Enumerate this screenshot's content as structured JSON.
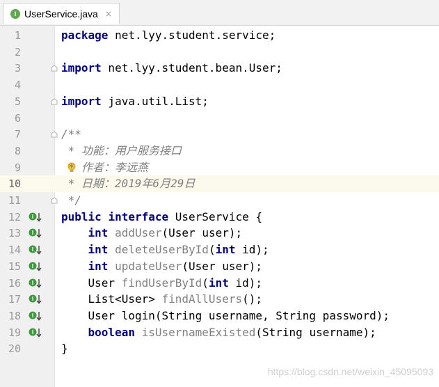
{
  "tab": {
    "icon_letter": "I",
    "file_name": "UserService.java",
    "close_label": "×"
  },
  "lines": [
    {
      "num": "1",
      "tokens": [
        {
          "t": "package",
          "c": "kw"
        },
        {
          "t": " net.lyy.student.service;",
          "c": "n"
        }
      ]
    },
    {
      "num": "2",
      "tokens": []
    },
    {
      "num": "3",
      "fold": true,
      "tokens": [
        {
          "t": "import",
          "c": "kw"
        },
        {
          "t": " net.lyy.student.bean.User;",
          "c": "n"
        }
      ]
    },
    {
      "num": "4",
      "tokens": []
    },
    {
      "num": "5",
      "fold": true,
      "tokens": [
        {
          "t": "import",
          "c": "kw"
        },
        {
          "t": " java.util.List;",
          "c": "n"
        }
      ]
    },
    {
      "num": "6",
      "tokens": []
    },
    {
      "num": "7",
      "fold": true,
      "tokens": [
        {
          "t": "/**",
          "c": "cm"
        }
      ]
    },
    {
      "num": "8",
      "tokens": [
        {
          "t": " * 功能：用户服务接口",
          "c": "cm"
        }
      ]
    },
    {
      "num": "9",
      "bulb": true,
      "tokens": [
        {
          "t": " * 作者：李远燕",
          "c": "cm"
        }
      ]
    },
    {
      "num": "10",
      "current": true,
      "tokens": [
        {
          "t": " * 日期：2019年6月29日",
          "c": "cm"
        }
      ]
    },
    {
      "num": "11",
      "fold": true,
      "tokens": [
        {
          "t": " */",
          "c": "cm"
        }
      ]
    },
    {
      "num": "12",
      "impl": true,
      "tokens": [
        {
          "t": "public",
          "c": "kw"
        },
        {
          "t": " ",
          "c": "n"
        },
        {
          "t": "interface",
          "c": "kw"
        },
        {
          "t": " UserService {",
          "c": "n"
        }
      ]
    },
    {
      "num": "13",
      "impl": true,
      "tokens": [
        {
          "t": "    ",
          "c": "n"
        },
        {
          "t": "int",
          "c": "kw"
        },
        {
          "t": " ",
          "c": "n"
        },
        {
          "t": "addUser",
          "c": "mt"
        },
        {
          "t": "(User user);",
          "c": "n"
        }
      ]
    },
    {
      "num": "14",
      "impl": true,
      "tokens": [
        {
          "t": "    ",
          "c": "n"
        },
        {
          "t": "int",
          "c": "kw"
        },
        {
          "t": " ",
          "c": "n"
        },
        {
          "t": "deleteUserById",
          "c": "mt"
        },
        {
          "t": "(",
          "c": "n"
        },
        {
          "t": "int",
          "c": "kw"
        },
        {
          "t": " id);",
          "c": "n"
        }
      ]
    },
    {
      "num": "15",
      "impl": true,
      "tokens": [
        {
          "t": "    ",
          "c": "n"
        },
        {
          "t": "int",
          "c": "kw"
        },
        {
          "t": " ",
          "c": "n"
        },
        {
          "t": "updateUser",
          "c": "mt"
        },
        {
          "t": "(User user);",
          "c": "n"
        }
      ]
    },
    {
      "num": "16",
      "impl": true,
      "tokens": [
        {
          "t": "    User ",
          "c": "n"
        },
        {
          "t": "findUserById",
          "c": "mt"
        },
        {
          "t": "(",
          "c": "n"
        },
        {
          "t": "int",
          "c": "kw"
        },
        {
          "t": " id);",
          "c": "n"
        }
      ]
    },
    {
      "num": "17",
      "impl": true,
      "tokens": [
        {
          "t": "    List<User> ",
          "c": "n"
        },
        {
          "t": "findAllUsers",
          "c": "mt"
        },
        {
          "t": "();",
          "c": "n"
        }
      ]
    },
    {
      "num": "18",
      "impl": true,
      "tokens": [
        {
          "t": "    User login(String username, String password);",
          "c": "n"
        }
      ]
    },
    {
      "num": "19",
      "impl": true,
      "tokens": [
        {
          "t": "    ",
          "c": "n"
        },
        {
          "t": "boolean",
          "c": "kw"
        },
        {
          "t": " ",
          "c": "n"
        },
        {
          "t": "isUsernameExisted",
          "c": "mt"
        },
        {
          "t": "(String username);",
          "c": "n"
        }
      ]
    },
    {
      "num": "20",
      "tokens": [
        {
          "t": "}",
          "c": "n"
        }
      ]
    }
  ],
  "watermark": "https://blog.csdn.net/weixin_45095093",
  "colors": {
    "keyword": "#000080",
    "comment": "#808080",
    "impl_icon": "#3c9a3c",
    "current_line": "#fcfaed"
  }
}
